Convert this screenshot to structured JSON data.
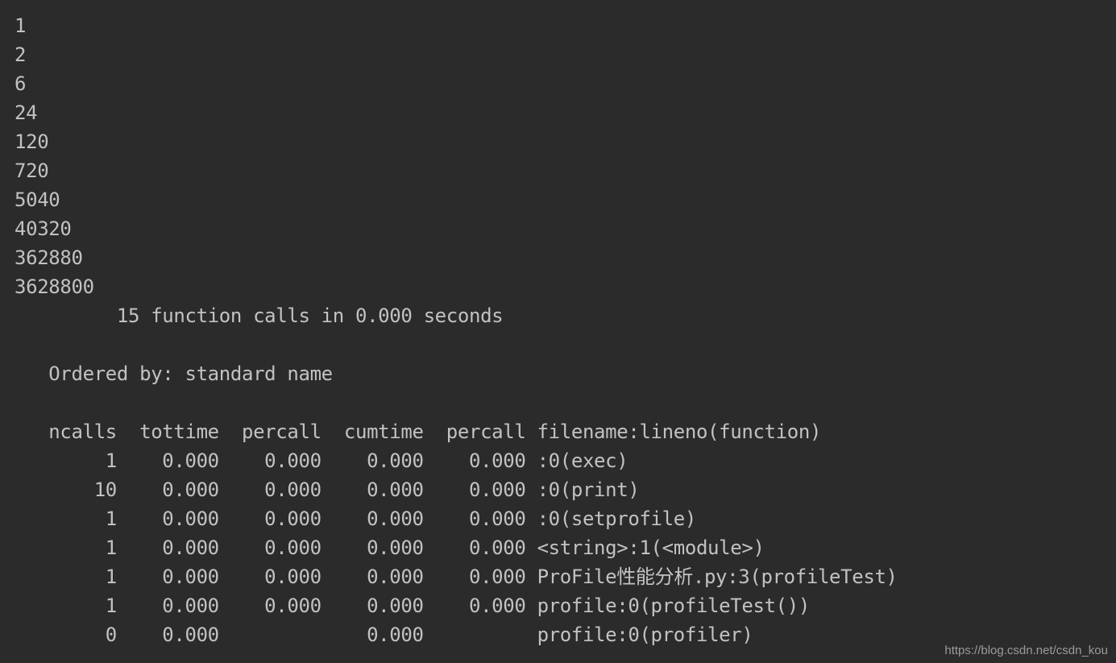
{
  "terminal": {
    "background_color": "#2b2b2b",
    "text_color": "#c2c2c2",
    "watermark_color": "#9b9b9b",
    "watermark": "https://blog.csdn.net/csdn_kou"
  },
  "program_output": {
    "title": "factorial results",
    "values": [
      "1",
      "2",
      "6",
      "24",
      "120",
      "720",
      "5040",
      "40320",
      "362880",
      "3628800"
    ]
  },
  "profile": {
    "summary": "         15 function calls in 0.000 seconds",
    "summary_calls": "15",
    "summary_seconds": "0.000",
    "blank_1": " ",
    "ordered_by": "   Ordered by: standard name",
    "ordered_by_value": "standard name",
    "blank_2": " ",
    "header": "   ncalls  tottime  percall  cumtime  percall filename:lineno(function)",
    "columns": [
      "ncalls",
      "tottime",
      "percall",
      "cumtime",
      "percall",
      "filename:lineno(function)"
    ],
    "rows": [
      {
        "line": "        1    0.000    0.000    0.000    0.000 :0(exec)",
        "ncalls": "1",
        "tottime": "0.000",
        "percall": "0.000",
        "cumtime": "0.000",
        "percall2": "0.000",
        "function": ":0(exec)"
      },
      {
        "line": "       10    0.000    0.000    0.000    0.000 :0(print)",
        "ncalls": "10",
        "tottime": "0.000",
        "percall": "0.000",
        "cumtime": "0.000",
        "percall2": "0.000",
        "function": ":0(print)"
      },
      {
        "line": "        1    0.000    0.000    0.000    0.000 :0(setprofile)",
        "ncalls": "1",
        "tottime": "0.000",
        "percall": "0.000",
        "cumtime": "0.000",
        "percall2": "0.000",
        "function": ":0(setprofile)"
      },
      {
        "line": "        1    0.000    0.000    0.000    0.000 <string>:1(<module>)",
        "ncalls": "1",
        "tottime": "0.000",
        "percall": "0.000",
        "cumtime": "0.000",
        "percall2": "0.000",
        "function": "<string>:1(<module>)"
      },
      {
        "line": "        1    0.000    0.000    0.000    0.000 ProFile性能分析.py:3(profileTest)",
        "ncalls": "1",
        "tottime": "0.000",
        "percall": "0.000",
        "cumtime": "0.000",
        "percall2": "0.000",
        "function": "ProFile性能分析.py:3(profileTest)"
      },
      {
        "line": "        1    0.000    0.000    0.000    0.000 profile:0(profileTest())",
        "ncalls": "1",
        "tottime": "0.000",
        "percall": "0.000",
        "cumtime": "0.000",
        "percall2": "0.000",
        "function": "profile:0(profileTest())"
      },
      {
        "line": "        0    0.000             0.000          profile:0(profiler)",
        "ncalls": "0",
        "tottime": "0.000",
        "percall": "",
        "cumtime": "0.000",
        "percall2": "",
        "function": "profile:0(profiler)"
      }
    ]
  }
}
